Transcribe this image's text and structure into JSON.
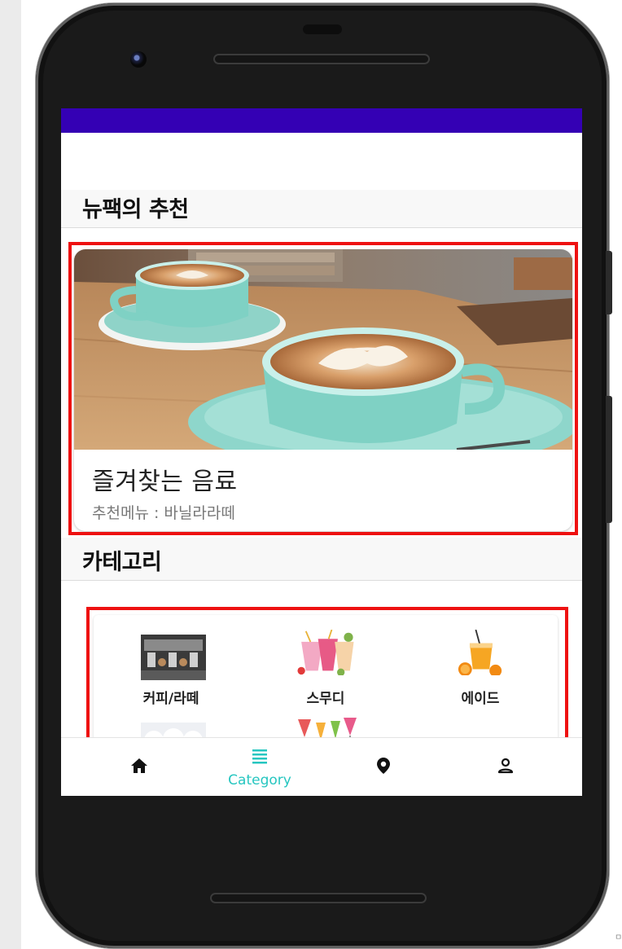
{
  "colors": {
    "status_bar": "#3400b4",
    "accent": "#26c6c0",
    "highlight_border": "#ee1111",
    "icon": "#111111"
  },
  "recommendation": {
    "section_title": "뉴팩의 추천",
    "card_title": "즐겨찾는 음료",
    "card_subtitle": "추천메뉴 : 바닐라라떼"
  },
  "categories": {
    "section_title": "카테고리",
    "items": [
      {
        "label": "커피/라떼",
        "icon": "coffee-machine-thumbnail"
      },
      {
        "label": "스무디",
        "icon": "smoothie-cups-thumbnail"
      },
      {
        "label": "에이드",
        "icon": "orange-juice-thumbnail"
      },
      {
        "label": "",
        "icon": "dessert-thumbnail"
      },
      {
        "label": "",
        "icon": "cocktail-thumbnail"
      }
    ]
  },
  "bottom_nav": {
    "items": [
      {
        "icon": "home-icon",
        "label": ""
      },
      {
        "icon": "list-icon",
        "label": "Category",
        "selected": true
      },
      {
        "icon": "location-pin-icon",
        "label": ""
      },
      {
        "icon": "person-icon",
        "label": ""
      }
    ]
  },
  "edge_text": "ㅁ"
}
